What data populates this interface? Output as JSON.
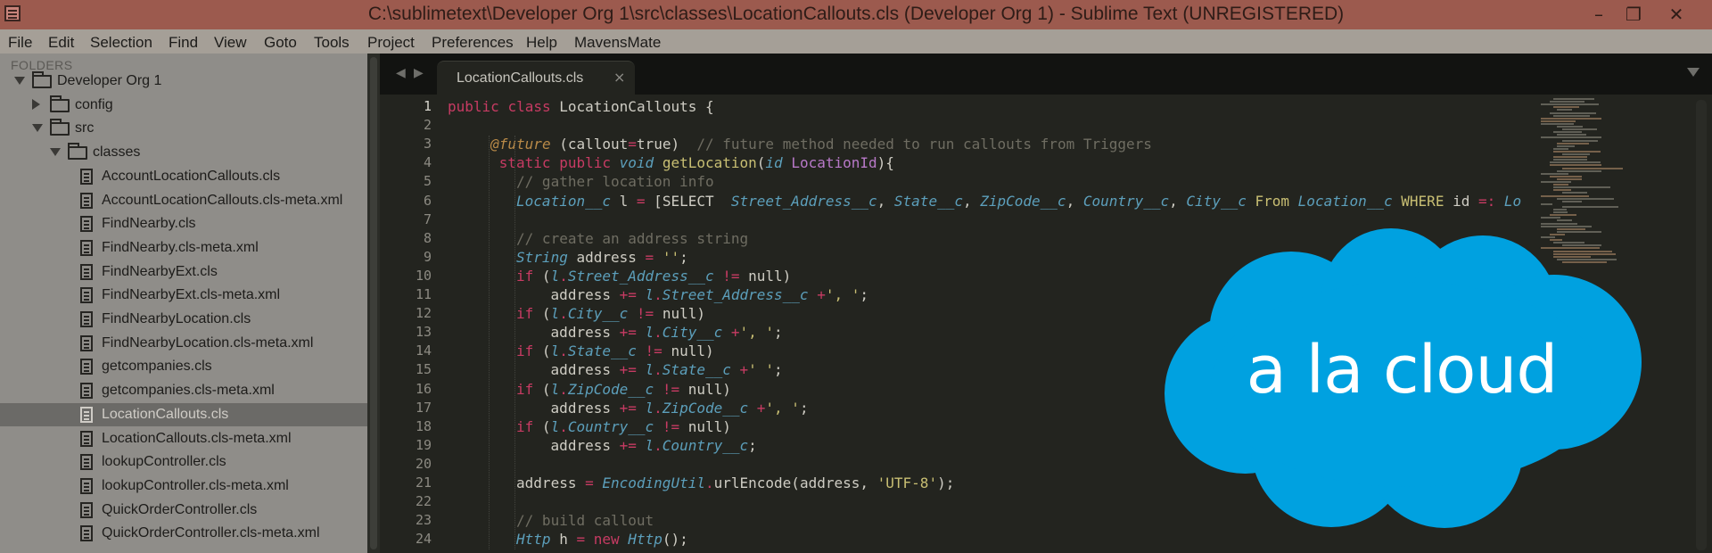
{
  "window": {
    "title": "C:\\sublimetext\\Developer Org 1\\src\\classes\\LocationCallouts.cls (Developer Org 1) - Sublime Text (UNREGISTERED)",
    "minimize_glyph": "–",
    "restore_glyph": "❐",
    "close_glyph": "✕"
  },
  "menu": [
    "File",
    "Edit",
    "Selection",
    "Find",
    "View",
    "Goto",
    "Tools",
    "Project",
    "Preferences",
    "Help",
    "MavensMate"
  ],
  "sidebar": {
    "header": "FOLDERS",
    "items": [
      {
        "label": "Developer Org 1",
        "kind": "folder",
        "expanded": true,
        "depth": 0
      },
      {
        "label": "config",
        "kind": "folder",
        "expanded": false,
        "depth": 1
      },
      {
        "label": "src",
        "kind": "folder",
        "expanded": true,
        "depth": 1
      },
      {
        "label": "classes",
        "kind": "folder",
        "expanded": true,
        "depth": 2
      },
      {
        "label": "AccountLocationCallouts.cls",
        "kind": "file",
        "depth": 3
      },
      {
        "label": "AccountLocationCallouts.cls-meta.xml",
        "kind": "file",
        "depth": 3
      },
      {
        "label": "FindNearby.cls",
        "kind": "file",
        "depth": 3
      },
      {
        "label": "FindNearby.cls-meta.xml",
        "kind": "file",
        "depth": 3
      },
      {
        "label": "FindNearbyExt.cls",
        "kind": "file",
        "depth": 3
      },
      {
        "label": "FindNearbyExt.cls-meta.xml",
        "kind": "file",
        "depth": 3
      },
      {
        "label": "FindNearbyLocation.cls",
        "kind": "file",
        "depth": 3
      },
      {
        "label": "FindNearbyLocation.cls-meta.xml",
        "kind": "file",
        "depth": 3
      },
      {
        "label": "getcompanies.cls",
        "kind": "file",
        "depth": 3
      },
      {
        "label": "getcompanies.cls-meta.xml",
        "kind": "file",
        "depth": 3
      },
      {
        "label": "LocationCallouts.cls",
        "kind": "file",
        "depth": 3,
        "selected": true
      },
      {
        "label": "LocationCallouts.cls-meta.xml",
        "kind": "file",
        "depth": 3
      },
      {
        "label": "lookupController.cls",
        "kind": "file",
        "depth": 3
      },
      {
        "label": "lookupController.cls-meta.xml",
        "kind": "file",
        "depth": 3
      },
      {
        "label": "QuickOrderController.cls",
        "kind": "file",
        "depth": 3
      },
      {
        "label": "QuickOrderController.cls-meta.xml",
        "kind": "file",
        "depth": 3
      }
    ]
  },
  "tabs": {
    "back_glyph": "◀",
    "forward_glyph": "▶",
    "active": {
      "label": "LocationCallouts.cls",
      "close": "×"
    }
  },
  "editor": {
    "current_line": 1,
    "lines": [
      {
        "n": "1",
        "indent": 0,
        "seg": [
          [
            "k",
            "public"
          ],
          [
            "p",
            " "
          ],
          [
            "k",
            "class"
          ],
          [
            "p",
            " LocationCallouts {"
          ]
        ]
      },
      {
        "n": "2",
        "indent": 0,
        "seg": []
      },
      {
        "n": "3",
        "indent": 5,
        "seg": [
          [
            "a",
            "@future"
          ],
          [
            "p",
            " (callout"
          ],
          [
            "o",
            "="
          ],
          [
            "p",
            "true)  "
          ],
          [
            "c",
            "// future method needed to run callouts from Triggers"
          ]
        ]
      },
      {
        "n": "4",
        "indent": 6,
        "seg": [
          [
            "k",
            "static"
          ],
          [
            "p",
            " "
          ],
          [
            "k",
            "public"
          ],
          [
            "p",
            " "
          ],
          [
            "t",
            "void"
          ],
          [
            "p",
            " "
          ],
          [
            "s",
            "getLocation"
          ],
          [
            "p",
            "("
          ],
          [
            "t",
            "id"
          ],
          [
            "p",
            " "
          ],
          [
            "v",
            "LocationId"
          ],
          [
            "p",
            "){"
          ]
        ]
      },
      {
        "n": "5",
        "indent": 8,
        "seg": [
          [
            "c",
            "// gather location info"
          ]
        ]
      },
      {
        "n": "6",
        "indent": 8,
        "seg": [
          [
            "t",
            "Location__c"
          ],
          [
            "p",
            " l "
          ],
          [
            "o",
            "="
          ],
          [
            "p",
            " [SELECT  "
          ],
          [
            "t",
            "Street_Address__c"
          ],
          [
            "p",
            ", "
          ],
          [
            "t",
            "State__c"
          ],
          [
            "p",
            ", "
          ],
          [
            "t",
            "ZipCode__c"
          ],
          [
            "p",
            ", "
          ],
          [
            "t",
            "Country__c"
          ],
          [
            "p",
            ", "
          ],
          [
            "t",
            "City__c"
          ],
          [
            "p",
            " "
          ],
          [
            "s",
            "From"
          ],
          [
            "p",
            " "
          ],
          [
            "t",
            "Location__c"
          ],
          [
            "p",
            " "
          ],
          [
            "s",
            "WHERE"
          ],
          [
            "p",
            " id "
          ],
          [
            "o",
            "=:"
          ],
          [
            "p",
            " "
          ],
          [
            "t",
            "Lo"
          ]
        ]
      },
      {
        "n": "7",
        "indent": 0,
        "seg": []
      },
      {
        "n": "8",
        "indent": 8,
        "seg": [
          [
            "c",
            "// create an address string"
          ]
        ]
      },
      {
        "n": "9",
        "indent": 8,
        "seg": [
          [
            "t",
            "String"
          ],
          [
            "p",
            " address "
          ],
          [
            "o",
            "="
          ],
          [
            "p",
            " "
          ],
          [
            "s",
            "''"
          ],
          [
            "p",
            ";"
          ]
        ]
      },
      {
        "n": "10",
        "indent": 8,
        "seg": [
          [
            "k",
            "if"
          ],
          [
            "p",
            " ("
          ],
          [
            "t",
            "l"
          ],
          [
            "o",
            "."
          ],
          [
            "t",
            "Street_Address__c"
          ],
          [
            "p",
            " "
          ],
          [
            "o",
            "!="
          ],
          [
            "p",
            " null)"
          ]
        ]
      },
      {
        "n": "11",
        "indent": 12,
        "seg": [
          [
            "p",
            "address "
          ],
          [
            "o",
            "+="
          ],
          [
            "p",
            " "
          ],
          [
            "t",
            "l"
          ],
          [
            "o",
            "."
          ],
          [
            "t",
            "Street_Address__c"
          ],
          [
            "p",
            " "
          ],
          [
            "o",
            "+"
          ],
          [
            "s",
            "', '"
          ],
          [
            "p",
            ";"
          ]
        ]
      },
      {
        "n": "12",
        "indent": 8,
        "seg": [
          [
            "k",
            "if"
          ],
          [
            "p",
            " ("
          ],
          [
            "t",
            "l"
          ],
          [
            "o",
            "."
          ],
          [
            "t",
            "City__c"
          ],
          [
            "p",
            " "
          ],
          [
            "o",
            "!="
          ],
          [
            "p",
            " null)"
          ]
        ]
      },
      {
        "n": "13",
        "indent": 12,
        "seg": [
          [
            "p",
            "address "
          ],
          [
            "o",
            "+="
          ],
          [
            "p",
            " "
          ],
          [
            "t",
            "l"
          ],
          [
            "o",
            "."
          ],
          [
            "t",
            "City__c"
          ],
          [
            "p",
            " "
          ],
          [
            "o",
            "+"
          ],
          [
            "s",
            "', '"
          ],
          [
            "p",
            ";"
          ]
        ]
      },
      {
        "n": "14",
        "indent": 8,
        "seg": [
          [
            "k",
            "if"
          ],
          [
            "p",
            " ("
          ],
          [
            "t",
            "l"
          ],
          [
            "o",
            "."
          ],
          [
            "t",
            "State__c"
          ],
          [
            "p",
            " "
          ],
          [
            "o",
            "!="
          ],
          [
            "p",
            " null)"
          ]
        ]
      },
      {
        "n": "15",
        "indent": 12,
        "seg": [
          [
            "p",
            "address "
          ],
          [
            "o",
            "+="
          ],
          [
            "p",
            " "
          ],
          [
            "t",
            "l"
          ],
          [
            "o",
            "."
          ],
          [
            "t",
            "State__c"
          ],
          [
            "p",
            " "
          ],
          [
            "o",
            "+"
          ],
          [
            "s",
            "' '"
          ],
          [
            "p",
            ";"
          ]
        ]
      },
      {
        "n": "16",
        "indent": 8,
        "seg": [
          [
            "k",
            "if"
          ],
          [
            "p",
            " ("
          ],
          [
            "t",
            "l"
          ],
          [
            "o",
            "."
          ],
          [
            "t",
            "ZipCode__c"
          ],
          [
            "p",
            " "
          ],
          [
            "o",
            "!="
          ],
          [
            "p",
            " null)"
          ]
        ]
      },
      {
        "n": "17",
        "indent": 12,
        "seg": [
          [
            "p",
            "address "
          ],
          [
            "o",
            "+="
          ],
          [
            "p",
            " "
          ],
          [
            "t",
            "l"
          ],
          [
            "o",
            "."
          ],
          [
            "t",
            "ZipCode__c"
          ],
          [
            "p",
            " "
          ],
          [
            "o",
            "+"
          ],
          [
            "s",
            "', '"
          ],
          [
            "p",
            ";"
          ]
        ]
      },
      {
        "n": "18",
        "indent": 8,
        "seg": [
          [
            "k",
            "if"
          ],
          [
            "p",
            " ("
          ],
          [
            "t",
            "l"
          ],
          [
            "o",
            "."
          ],
          [
            "t",
            "Country__c"
          ],
          [
            "p",
            " "
          ],
          [
            "o",
            "!="
          ],
          [
            "p",
            " null)"
          ]
        ]
      },
      {
        "n": "19",
        "indent": 12,
        "seg": [
          [
            "p",
            "address "
          ],
          [
            "o",
            "+="
          ],
          [
            "p",
            " "
          ],
          [
            "t",
            "l"
          ],
          [
            "o",
            "."
          ],
          [
            "t",
            "Country__c"
          ],
          [
            "p",
            ";"
          ]
        ]
      },
      {
        "n": "20",
        "indent": 0,
        "seg": []
      },
      {
        "n": "21",
        "indent": 8,
        "seg": [
          [
            "p",
            "address "
          ],
          [
            "o",
            "="
          ],
          [
            "p",
            " "
          ],
          [
            "t",
            "EncodingUtil"
          ],
          [
            "o",
            "."
          ],
          [
            "p",
            "urlEncode(address, "
          ],
          [
            "s",
            "'UTF-8'"
          ],
          [
            "p",
            ");"
          ]
        ]
      },
      {
        "n": "22",
        "indent": 0,
        "seg": []
      },
      {
        "n": "23",
        "indent": 8,
        "seg": [
          [
            "c",
            "// build callout"
          ]
        ]
      },
      {
        "n": "24",
        "indent": 8,
        "seg": [
          [
            "t",
            "Http"
          ],
          [
            "p",
            " h "
          ],
          [
            "o",
            "="
          ],
          [
            "p",
            " "
          ],
          [
            "k",
            "new"
          ],
          [
            "p",
            " "
          ],
          [
            "t",
            "Http"
          ],
          [
            "p",
            "();"
          ]
        ]
      }
    ]
  },
  "logo": {
    "text": "a la cloud",
    "color": "#00a1e0"
  },
  "colors": {
    "titlebar": "#9c5a4e",
    "menubar": "#a59f97",
    "sidebar": "#8f8d89",
    "editor_bg": "#23241f",
    "keyword": "#c73b63",
    "type": "#5c9fbb",
    "comment": "#6f6d62",
    "string": "#c9bf73"
  }
}
